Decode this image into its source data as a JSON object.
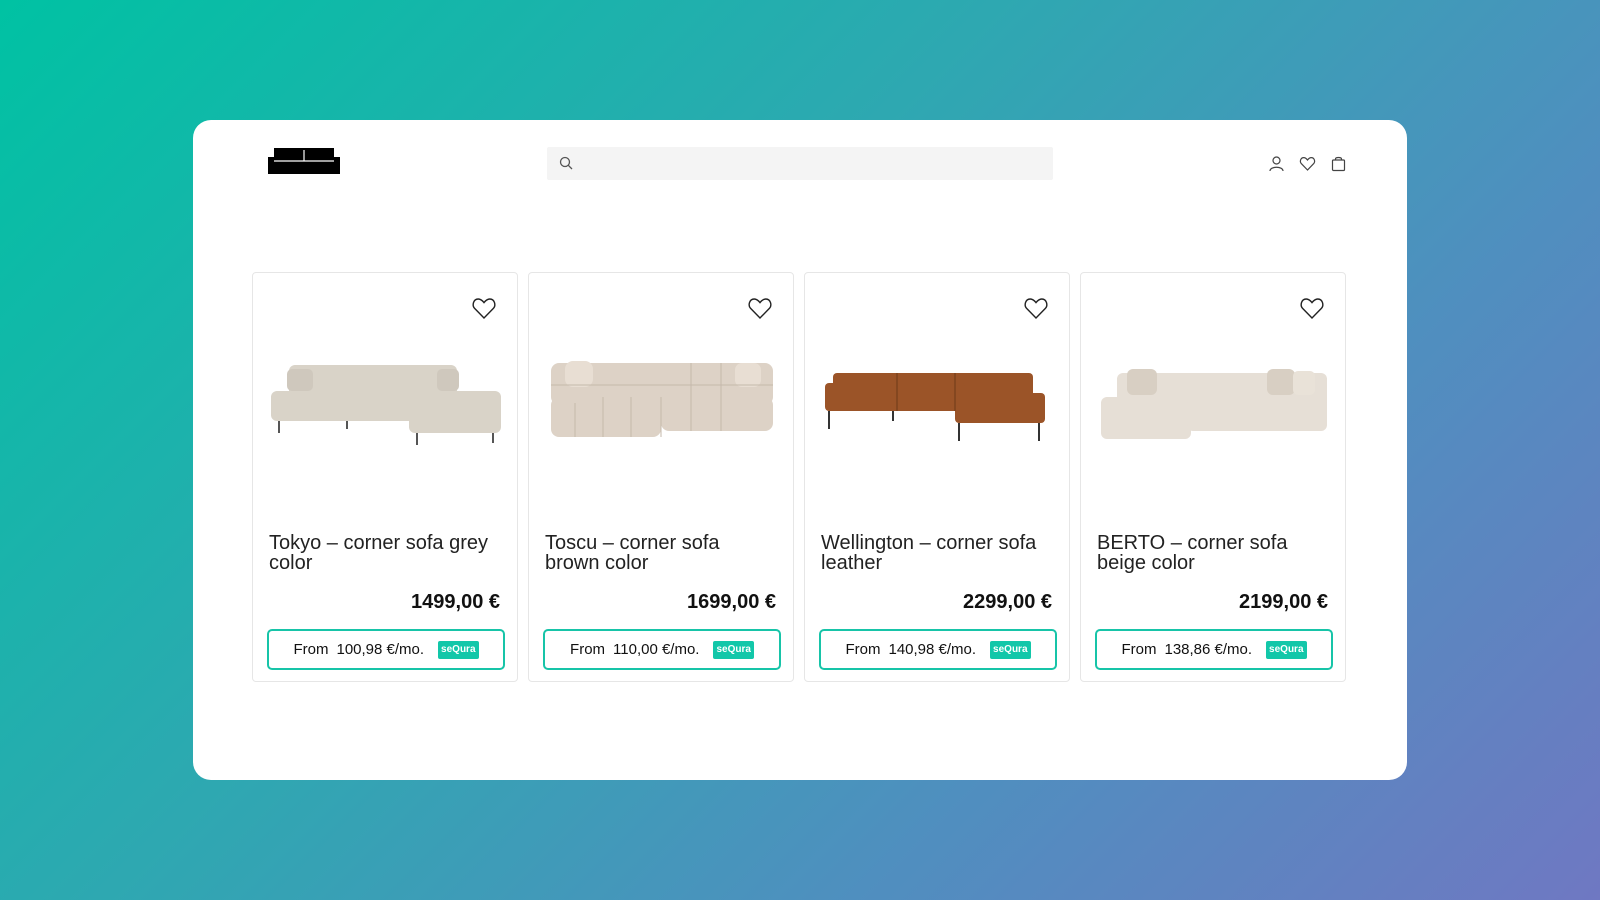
{
  "colors": {
    "accent": "#17c4a8",
    "background_start": "#00c2a3",
    "background_end": "#6f78c2"
  },
  "header": {
    "logo_icon": "sofa-logo-icon",
    "search": {
      "placeholder": "",
      "icon": "search-icon"
    },
    "icons": [
      "user-icon",
      "heart-icon",
      "bag-icon"
    ]
  },
  "products": [
    {
      "title": "Tokyo – corner sofa grey color",
      "price": "1499,00 €",
      "finance": {
        "from": "From",
        "amount": "100,98 €/mo.",
        "badge": "seQura"
      },
      "color": "#d9d3c8"
    },
    {
      "title": "Toscu – corner sofa brown color",
      "price": "1699,00 €",
      "finance": {
        "from": "From",
        "amount": "110,00 €/mo.",
        "badge": "seQura"
      },
      "color": "#ddd2c6"
    },
    {
      "title": "Wellington – corner sofa leather",
      "price": "2299,00 €",
      "finance": {
        "from": "From",
        "amount": "140,98 €/mo.",
        "badge": "seQura"
      },
      "color": "#9b5428"
    },
    {
      "title": "BERTO – corner sofa beige color",
      "price": "2199,00 €",
      "finance": {
        "from": "From",
        "amount": "138,86 €/mo.",
        "badge": "seQura"
      },
      "color": "#e6dfd6"
    }
  ]
}
